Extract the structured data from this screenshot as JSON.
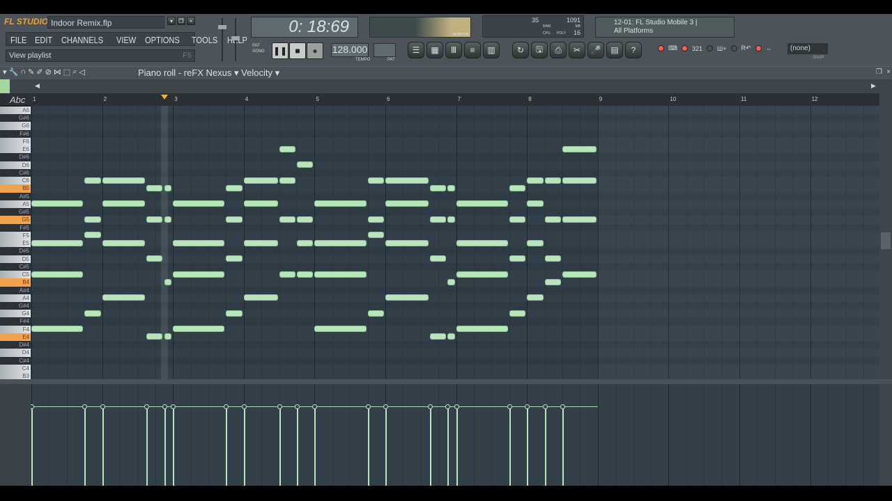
{
  "app": {
    "logo": "FL STUDIO",
    "project": "Indoor Remix.flp",
    "menu": [
      "FILE",
      "EDIT",
      "CHANNELS",
      "VIEW",
      "OPTIONS",
      "TOOLS",
      "HELP"
    ],
    "hint": "View playlist",
    "hint_key": "F5"
  },
  "transport": {
    "time": "0: 18:69",
    "pat_label": "PAT",
    "song_label": "SONG",
    "tempo": "128.000",
    "tempo_label": "TEMPO",
    "pat_num_label": "PAT",
    "monitor_label": "MONITOR"
  },
  "cpu": {
    "value": "35",
    "ram": "1091",
    "ram_label": "RAM",
    "mb_label": "MB",
    "cpu_label": "CPU",
    "poly_label": "POLY",
    "poly": "16"
  },
  "news": {
    "line1": "12-01: FL Studio Mobile 3 |",
    "line2": "All Platforms"
  },
  "snap": {
    "value": "(none)",
    "label": "SNAP"
  },
  "pianoroll": {
    "title": "Piano roll - reFX Nexus",
    "target": "Velocity",
    "abc": "Abc",
    "bars": [
      "1",
      "2",
      "3",
      "4",
      "5",
      "6",
      "7",
      "8",
      "9",
      "10",
      "11",
      "12"
    ],
    "keys": [
      "A6",
      "G#6",
      "G6",
      "F#6",
      "F6",
      "E6",
      "D#6",
      "D6",
      "C#6",
      "C6",
      "B5",
      "A#5",
      "A5",
      "G#5",
      "G5",
      "F#5",
      "F5",
      "E5",
      "D#5",
      "D5",
      "C#5",
      "C5",
      "B4",
      "A#4",
      "A4",
      "G#4",
      "G4",
      "F#4",
      "F4",
      "E4",
      "D#4",
      "D4",
      "C#4",
      "C4",
      "B3"
    ],
    "highlighted_keys": [
      "B5",
      "G5",
      "B4",
      "E4"
    ],
    "note_color": "#b8e5bb",
    "grid_color": "#33404a",
    "playhead_beat": 7.5,
    "velocity": 0.78
  },
  "chart_data": {
    "type": "piano-roll",
    "unit": "beats",
    "notes": [
      [
        "E6",
        14,
        1
      ],
      [
        "E6",
        30,
        2
      ],
      [
        "D6",
        15,
        1
      ],
      [
        "C6",
        3,
        1
      ],
      [
        "C6",
        4,
        2.5
      ],
      [
        "C6",
        12,
        2
      ],
      [
        "C6",
        14,
        1
      ],
      [
        "C6",
        19,
        1
      ],
      [
        "C6",
        20,
        2.5
      ],
      [
        "C6",
        28,
        1
      ],
      [
        "C6",
        29,
        1
      ],
      [
        "C6",
        30,
        2
      ],
      [
        "B5",
        6.5,
        1
      ],
      [
        "B5",
        7.5,
        0.5
      ],
      [
        "B5",
        11,
        1
      ],
      [
        "B5",
        22.5,
        1
      ],
      [
        "B5",
        23.5,
        0.5
      ],
      [
        "B5",
        27,
        1
      ],
      [
        "A5",
        0,
        3
      ],
      [
        "A5",
        4,
        2.5
      ],
      [
        "A5",
        8,
        3
      ],
      [
        "A5",
        12,
        2
      ],
      [
        "A5",
        16,
        3
      ],
      [
        "A5",
        20,
        2.5
      ],
      [
        "A5",
        24,
        3
      ],
      [
        "A5",
        28,
        1
      ],
      [
        "G5",
        3,
        1
      ],
      [
        "G5",
        6.5,
        1
      ],
      [
        "G5",
        7.5,
        0.5
      ],
      [
        "G5",
        11,
        1
      ],
      [
        "G5",
        14,
        1
      ],
      [
        "G5",
        15,
        1
      ],
      [
        "G5",
        19,
        1
      ],
      [
        "G5",
        22.5,
        1
      ],
      [
        "G5",
        23.5,
        0.5
      ],
      [
        "G5",
        27,
        1
      ],
      [
        "G5",
        29,
        1
      ],
      [
        "G5",
        30,
        2
      ],
      [
        "F5",
        3,
        1
      ],
      [
        "F5",
        19,
        1
      ],
      [
        "E5",
        0,
        3
      ],
      [
        "E5",
        4,
        2.5
      ],
      [
        "E5",
        8,
        3
      ],
      [
        "E5",
        12,
        2
      ],
      [
        "E5",
        15,
        1
      ],
      [
        "E5",
        16,
        3
      ],
      [
        "E5",
        20,
        2.5
      ],
      [
        "E5",
        24,
        3
      ],
      [
        "E5",
        28,
        1
      ],
      [
        "D5",
        6.5,
        1
      ],
      [
        "D5",
        11,
        1
      ],
      [
        "D5",
        22.5,
        1
      ],
      [
        "D5",
        27,
        1
      ],
      [
        "D5",
        29,
        1
      ],
      [
        "C5",
        0,
        3
      ],
      [
        "C5",
        8,
        3
      ],
      [
        "C5",
        14,
        1
      ],
      [
        "C5",
        15,
        1
      ],
      [
        "C5",
        16,
        3
      ],
      [
        "C5",
        24,
        3
      ],
      [
        "C5",
        30,
        2
      ],
      [
        "B4",
        7.5,
        0.5
      ],
      [
        "B4",
        23.5,
        0.5
      ],
      [
        "B4",
        29,
        1
      ],
      [
        "A4",
        4,
        2.5
      ],
      [
        "A4",
        12,
        2
      ],
      [
        "A4",
        20,
        2.5
      ],
      [
        "A4",
        28,
        1
      ],
      [
        "G4",
        3,
        1
      ],
      [
        "G4",
        11,
        1
      ],
      [
        "G4",
        19,
        1
      ],
      [
        "G4",
        27,
        1
      ],
      [
        "F4",
        0,
        3
      ],
      [
        "F4",
        8,
        3
      ],
      [
        "F4",
        16,
        3
      ],
      [
        "F4",
        24,
        3
      ],
      [
        "E4",
        6.5,
        1
      ],
      [
        "E4",
        7.5,
        0.5
      ],
      [
        "E4",
        22.5,
        1
      ],
      [
        "E4",
        23.5,
        0.5
      ]
    ]
  }
}
